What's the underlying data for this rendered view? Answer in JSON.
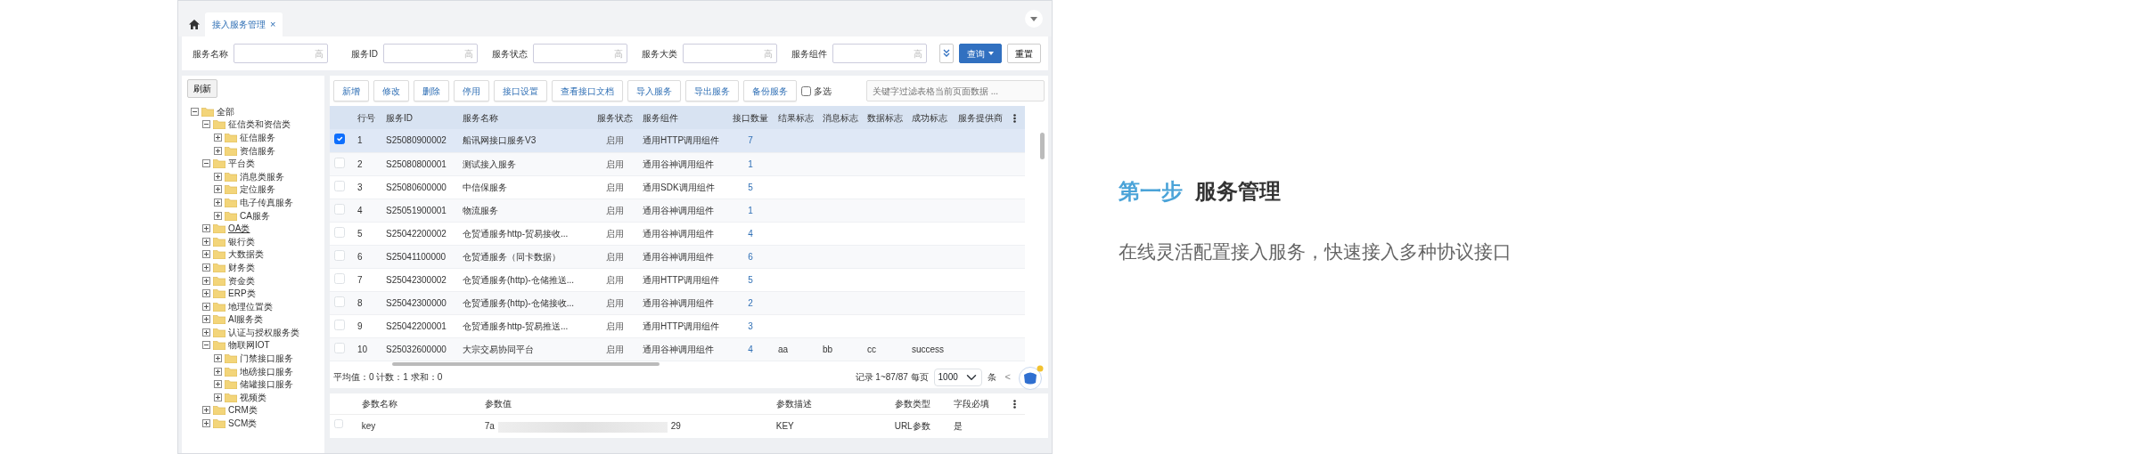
{
  "tabs": [
    {
      "label": "接入服务管理",
      "close": "×",
      "selected": true
    }
  ],
  "filters": [
    {
      "label": "服务名称",
      "suffix": "高"
    },
    {
      "label": "服务ID",
      "suffix": "高"
    },
    {
      "label": "服务状态",
      "suffix": "高"
    },
    {
      "label": "服务大类",
      "suffix": "高"
    },
    {
      "label": "服务组件",
      "suffix": "高"
    }
  ],
  "filter_buttons": {
    "query": "查询",
    "reset": "重置"
  },
  "tree_panel": {
    "refresh": "刷新",
    "tree": [
      {
        "label": "全部",
        "expanded": true,
        "selected": false,
        "children": [
          {
            "label": "征信类和资信类",
            "expanded": true,
            "selected": false,
            "children": [
              {
                "label": "征信服务",
                "expanded": false,
                "selected": false
              },
              {
                "label": "资信服务",
                "expanded": false,
                "selected": false
              }
            ]
          },
          {
            "label": "平台类",
            "expanded": true,
            "selected": false,
            "children": [
              {
                "label": "消息类服务",
                "expanded": false,
                "selected": false
              },
              {
                "label": "定位服务",
                "expanded": false,
                "selected": false
              },
              {
                "label": "电子传真服务",
                "expanded": false,
                "selected": false
              },
              {
                "label": "CA服务",
                "expanded": false,
                "selected": false
              }
            ]
          },
          {
            "label": "OA类",
            "expanded": false,
            "selected": true
          },
          {
            "label": "银行类",
            "expanded": false,
            "selected": false
          },
          {
            "label": "大数据类",
            "expanded": false,
            "selected": false
          },
          {
            "label": "财务类",
            "expanded": false,
            "selected": false
          },
          {
            "label": "资金类",
            "expanded": false,
            "selected": false
          },
          {
            "label": "ERP类",
            "expanded": false,
            "selected": false
          },
          {
            "label": "地理位置类",
            "expanded": false,
            "selected": false
          },
          {
            "label": "AI服务类",
            "expanded": false,
            "selected": false
          },
          {
            "label": "认证与授权服务类",
            "expanded": false,
            "selected": false
          },
          {
            "label": "物联网IOT",
            "expanded": true,
            "selected": false,
            "children": [
              {
                "label": "门禁接口服务",
                "expanded": false,
                "selected": false
              },
              {
                "label": "地磅接口服务",
                "expanded": false,
                "selected": false
              },
              {
                "label": "储罐接口服务",
                "expanded": false,
                "selected": false
              },
              {
                "label": "视频类",
                "expanded": false,
                "selected": false
              }
            ]
          },
          {
            "label": "CRM类",
            "expanded": false,
            "selected": false
          },
          {
            "label": "SCM类",
            "expanded": false,
            "selected": false
          }
        ]
      }
    ]
  },
  "toolbar": {
    "buttons": [
      "新增",
      "修改",
      "删除",
      "停用",
      "接口设置",
      "查看接口文档",
      "导入服务",
      "导出服务",
      "备份服务"
    ],
    "multi_select": {
      "label": "多选",
      "checked": false
    },
    "search": {
      "placeholder": "关键字过滤表格当前页面数据 ..."
    }
  },
  "table": {
    "columns": [
      "行号",
      "服务ID",
      "服务名称",
      "服务状态",
      "服务组件",
      "接口数量",
      "结果标志",
      "消息标志",
      "数据标志",
      "成功标志",
      "服务提供商"
    ],
    "rows": [
      {
        "selected": true,
        "cells": [
          "1",
          "S25080900002",
          "船讯网接口服务V3",
          "启用",
          "通用HTTP调用组件",
          "7"
        ]
      },
      {
        "selected": false,
        "cells": [
          "2",
          "S25080800001",
          "测试接入服务",
          "启用",
          "通用谷神调用组件",
          "1"
        ]
      },
      {
        "selected": false,
        "cells": [
          "3",
          "S25080600000",
          "中信保服务",
          "启用",
          "通用SDK调用组件",
          "5"
        ]
      },
      {
        "selected": false,
        "cells": [
          "4",
          "S25051900001",
          "物流服务",
          "启用",
          "通用谷神调用组件",
          "1"
        ]
      },
      {
        "selected": false,
        "cells": [
          "5",
          "S25042200002",
          "仓贸通服务http-贸易接收...",
          "启用",
          "通用谷神调用组件",
          "4"
        ]
      },
      {
        "selected": false,
        "cells": [
          "6",
          "S25041100000",
          "仓贸通服务（同卡数据）",
          "启用",
          "通用谷神调用组件",
          "6"
        ]
      },
      {
        "selected": false,
        "cells": [
          "7",
          "S25042300002",
          "仓贸通服务(http)-仓储推送...",
          "启用",
          "通用HTTP调用组件",
          "5"
        ]
      },
      {
        "selected": false,
        "cells": [
          "8",
          "S25042300000",
          "仓贸通服务(http)-仓储接收...",
          "启用",
          "通用谷神调用组件",
          "2"
        ]
      },
      {
        "selected": false,
        "cells": [
          "9",
          "S25042200001",
          "仓贸通服务http-贸易推送...",
          "启用",
          "通用HTTP调用组件",
          "3"
        ]
      },
      {
        "selected": false,
        "cells": [
          "10",
          "S25032600000",
          "大宗交易协同平台",
          "启用",
          "通用谷神调用组件",
          "4",
          "aa",
          "bb",
          "cc",
          "success"
        ]
      }
    ]
  },
  "footer": {
    "stats": "平均值：0 计数：1 求和：0",
    "records": "记录 1~87/87 每页",
    "page_size": "1000",
    "unit": "条",
    "prev": "<"
  },
  "params": {
    "columns": [
      "参数名称",
      "参数值",
      "参数描述",
      "参数类型",
      "字段必填"
    ],
    "rows": [
      {
        "checked": false,
        "cells": [
          "key",
          {
            "start": "7a",
            "end": "29"
          },
          "KEY",
          "URL参数",
          "是"
        ]
      }
    ]
  },
  "intro": {
    "step": "第一步",
    "title": "服务管理",
    "description": "在线灵活配置接入服务，快速接入多种协议接口"
  }
}
